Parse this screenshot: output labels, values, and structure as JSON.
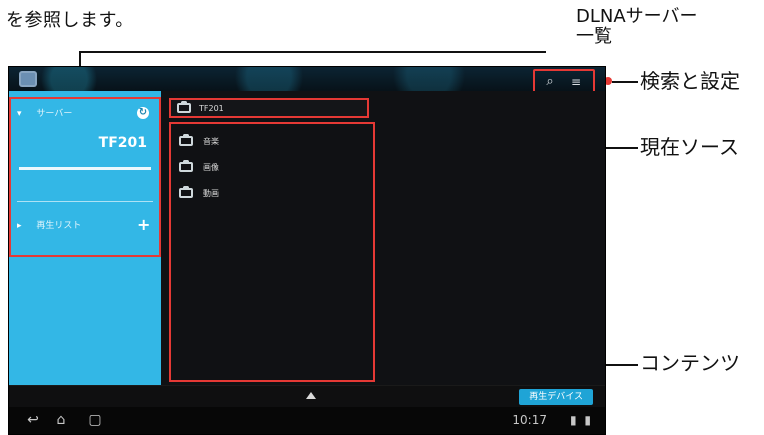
{
  "page": {
    "top_text": "を参照します。"
  },
  "callouts": {
    "dlna_list_line1": "DLNAサーバー",
    "dlna_list_line2": "一覧",
    "search_settings": "検索と設定",
    "current_source": "現在ソース",
    "contents": "コンテンツ"
  },
  "ui": {
    "sidebar": {
      "server_header": "サーバー",
      "server_name": "TF201",
      "playlist": "再生リスト"
    },
    "main": {
      "source": "TF201",
      "items": [
        "音楽",
        "画像",
        "動画"
      ]
    },
    "bottom": {
      "playback_device": "再生デバイス"
    },
    "system": {
      "time": "10:17"
    }
  },
  "colors": {
    "accent": "#33b7e6",
    "callout_red": "#e53935"
  }
}
